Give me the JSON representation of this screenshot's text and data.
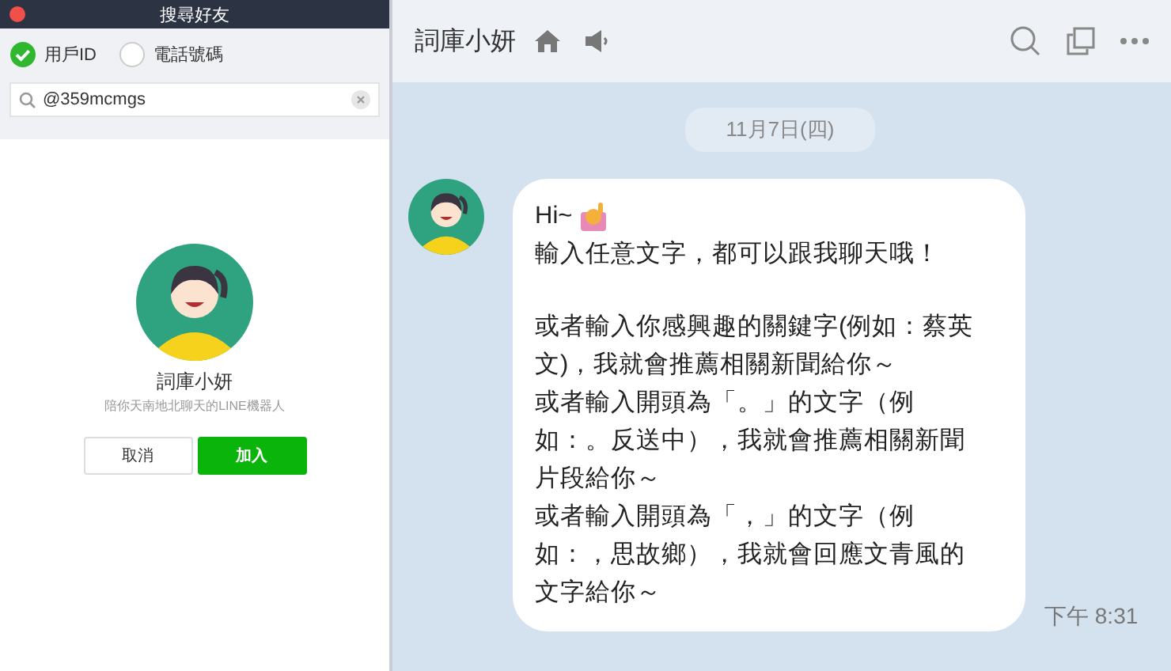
{
  "dialog": {
    "title": "搜尋好友",
    "search_by": [
      {
        "label": "用戶ID",
        "selected": true
      },
      {
        "label": "電話號碼",
        "selected": false
      }
    ],
    "search": {
      "value": "@359mcmgs"
    },
    "result": {
      "name": "詞庫小妍",
      "description": "陪你天南地北聊天的LINE機器人"
    },
    "buttons": [
      {
        "label": "取消",
        "kind": "secondary"
      },
      {
        "label": "加入",
        "kind": "primary"
      }
    ]
  },
  "chat": {
    "title": "詞庫小妍",
    "date": "11月7日(四)",
    "message": {
      "greeting": "Hi~",
      "paragraphs": [
        [
          "輸入任意文字，都可以跟我聊天哦！"
        ],
        [
          "或者輸入你感興趣的關鍵字(例如：蔡英",
          "文)，我就會推薦相關新聞給你～",
          "或者輸入開頭為「。」的文字（例",
          "如：。反送中），我就會推薦相關新聞",
          "片段給你～",
          "或者輸入開頭為「，」的文字（例",
          "如：，思故鄉），我就會回應文青風的",
          "文字給你～"
        ]
      ],
      "time": "下午 8:31"
    }
  }
}
